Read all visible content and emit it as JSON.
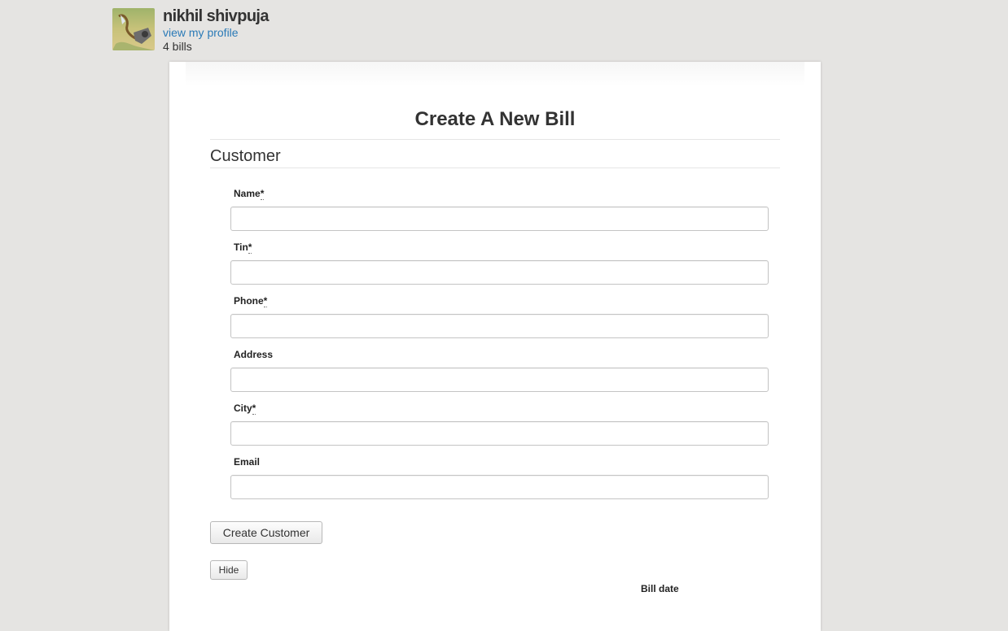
{
  "profile": {
    "name": "nikhil shivpuja",
    "view_profile": "view my profile",
    "bills_count": "4 bills"
  },
  "page": {
    "title": "Create A New Bill"
  },
  "customer_section": {
    "title": "Customer",
    "fields": [
      {
        "label": "Name",
        "required_mark": "*",
        "value": ""
      },
      {
        "label": "Tin",
        "required_mark": "*",
        "value": ""
      },
      {
        "label": "Phone",
        "required_mark": "*",
        "value": ""
      },
      {
        "label": "Address",
        "required_mark": "",
        "value": ""
      },
      {
        "label": "City",
        "required_mark": "*",
        "value": ""
      },
      {
        "label": "Email",
        "required_mark": "",
        "value": ""
      }
    ],
    "create_button": "Create Customer",
    "hide_button": "Hide"
  },
  "bill": {
    "date_label": "Bill date"
  },
  "colors": {
    "background": "#e5e4e2",
    "link": "#2a7ab7",
    "panel": "#ffffff"
  }
}
